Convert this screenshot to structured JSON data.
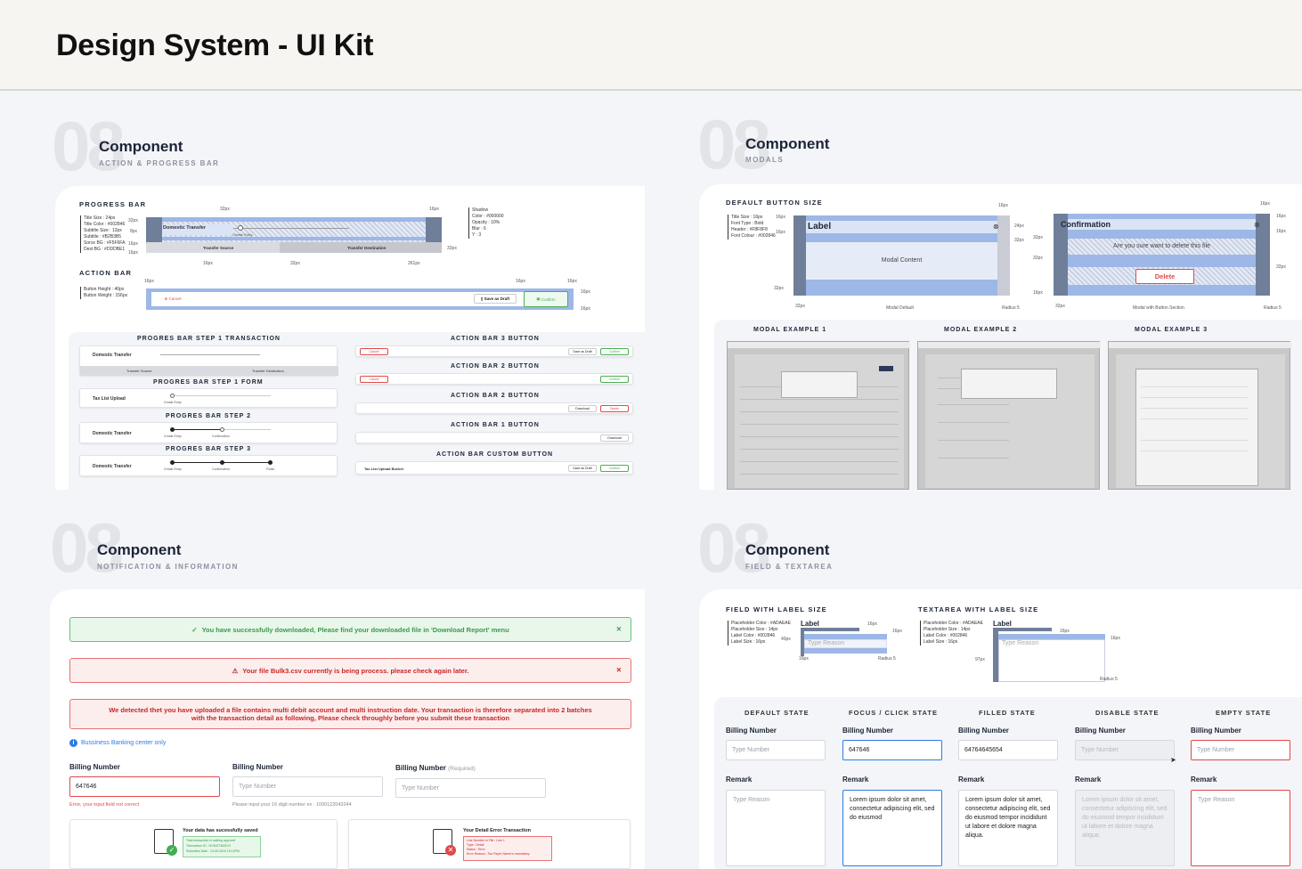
{
  "title": "Design System - UI Kit",
  "section_number": "08",
  "q1": {
    "heading": "Component",
    "subheading": "ACTION & PROGRESS BAR",
    "progress_label": "PROGRESS BAR",
    "spec": [
      "Title Size : 24px",
      "Title Color : #002846",
      "Subtitle Size : 12px",
      "Subtitle : #B2B3B5",
      "Sorce BG : #F5F6FA",
      "Dest BG : #DDDBE1"
    ],
    "spec_px": [
      "32px",
      "8px",
      "16px",
      "16px"
    ],
    "shadow": [
      "Shadow",
      "Color : #000000",
      "Opacity : 10%",
      "Blur : 6",
      "Y : 3"
    ],
    "dims": {
      "a": "32px",
      "b": "16px",
      "c": "16px",
      "d": "32px",
      "e": "16px",
      "f": "32px",
      "g": "261px"
    },
    "pb": {
      "title": "Domestic Transfer",
      "step1": "Create Entry",
      "source": "Transfer Source",
      "dest": "Transfer Destination"
    },
    "action_label": "ACTION BAR",
    "action_spec": [
      "Button Height : 40px",
      "Button Weight : 156px"
    ],
    "action_dims": {
      "a": "16px",
      "b": "16px",
      "c": "16px",
      "d": "16px",
      "e": "16px"
    },
    "ab": {
      "cancel": "Cancel",
      "draft": "Save as Draft",
      "confirm": "Confirm"
    },
    "left_titles": [
      "PROGRES BAR STEP 1 TRANSACTION",
      "PROGRES BAR STEP 1 FORM",
      "PROGRES BAR STEP 2",
      "PROGRES BAR STEP 3"
    ],
    "left_items": [
      "Domestic Transfer",
      "Tax List Upload",
      "Domestic Transfer",
      "Domestic Transfer"
    ],
    "steps": [
      "Create Entry",
      "Confirmation",
      "Finish"
    ],
    "right_titles": [
      "ACTION BAR 3 BUTTON",
      "ACTION BAR 2 BUTTON",
      "ACTION BAR 2 BUTTON",
      "ACTION BAR 1 BUTTON",
      "ACTION BAR CUSTOM BUTTON"
    ],
    "rb": {
      "cancel": "Cancel",
      "draft": "Save as Draft",
      "confirm": "Confirm",
      "download": "Download",
      "delete": "Delete",
      "bucket": "Tax List Upload Bucket"
    }
  },
  "q2": {
    "heading": "Component",
    "subheading": "MODALS",
    "label": "DEFAULT BUTTON SIZE",
    "spec": [
      "Title Size : 16px",
      "Font Type : Bold",
      "Header : #F8F8F8",
      "Font Colour : #002846"
    ],
    "spec_px": [
      "16px",
      "16px"
    ],
    "m1": {
      "title": "Label",
      "content": "Modal Content",
      "caption": "Modal Default",
      "radius": "Radius 5",
      "d16": "16px",
      "d24": "24px",
      "d32": "32px",
      "d32b": "32px",
      "d32c": "32px"
    },
    "m2": {
      "title": "Confirmation",
      "content": "Are you sure want to delete this file",
      "button": "Delete",
      "caption": "Modal with Button Section",
      "radius": "Radius 5",
      "d16": "16px",
      "d16b": "16px",
      "d32": "32px",
      "d32b": "32px",
      "d16c": "16px",
      "d32c": "32px"
    },
    "examples": [
      "MODAL EXAMPLE 1",
      "MODAL EXAMPLE 2",
      "MODAL EXAMPLE 3"
    ]
  },
  "q3": {
    "heading": "Component",
    "subheading": "NOTIFICATION & INFORMATION",
    "success": "You have successfully downloaded, Please find your downloaded file in 'Download Report' menu",
    "warning": "Your file Bulk3.csv currently is being process. please check again later.",
    "error": "We detected thet you have uploaded a file contains multi debit account and multi instruction date. Your transaction is therefore separated into 2 batches with the transaction detail as following, Please check throughly before you submit these transaction",
    "info": "Bussiness Banking center only",
    "f1": {
      "label": "Billing Number",
      "value": "647646",
      "error": "Error, your input field not correct"
    },
    "f2": {
      "label": "Billing Number",
      "placeholder": "Type Number",
      "hint": "Please input your 16 digit number ex : 1000122043244"
    },
    "f3": {
      "label": "Billing Number",
      "req": "(Required)",
      "placeholder": "Type Number"
    },
    "c1": {
      "title": "Your data has sucessfully saved",
      "lines": [
        "Total transaction is waiting approvel",
        "Transaction ID : 00 8437383013",
        "Submitted Date : 14-05-2019 15:12PM"
      ]
    },
    "c2": {
      "title": "Your Detail Error Transaction",
      "lines": [
        "Line Number in File : Line 1",
        "Type : Detail",
        "Status : Error",
        "Error Reason : Tax Payer Name is mandatory"
      ]
    }
  },
  "q4": {
    "heading": "Component",
    "subheading": "FIELD & TEXTAREA",
    "fl": "FIELD WITH LABEL SIZE",
    "tl": "TEXTAREA WITH LABEL SIZE",
    "fspec": [
      "Placeholder Color : #ADAEAE",
      "Placeholder Size : 14px",
      "Label Color : #002846",
      "Label Size : 16px"
    ],
    "tspec": [
      "Placeholder Color : #ADAEAE",
      "Placeholder Size : 14px",
      "Label Color : #002846",
      "Label Size : 16px"
    ],
    "fdemo": {
      "label": "Label",
      "placeholder": "Type Reason",
      "d16a": "16px",
      "d16b": "16px",
      "d40": "40px",
      "d16c": "16px",
      "radius": "Radius 5"
    },
    "tdemo": {
      "label": "Label",
      "placeholder": "Type Reason",
      "d16a": "16px",
      "d16b": "16px",
      "d97": "97px",
      "radius": "Radius 5"
    },
    "states": [
      "DEFAULT STATE",
      "FOCUS / CLICK STATE",
      "FILLED STATE",
      "DISABLE STATE",
      "EMPTY STATE"
    ],
    "billing": "Billing Number",
    "remark": "Remark",
    "ph_num": "Type Number",
    "ph_reason": "Type Reason",
    "focus_val": "647646",
    "filled_val": "64764645654",
    "lorem1": "Lorem ipsum dolor sit amet, consectetur adipiscing elit, sed do eiusmod",
    "lorem2": "Lorem ipsum dolor sit amet, consectetur adipiscing elit, sed do eiusmod tempor incididunt ut labore et dolore magna aliqua.",
    "lorem3": "Lorem ipsum dolor sit amet, consectetur adipiscing elit, sed do eiusmod tempor incididunt ut labore et dolore magna aliqua."
  },
  "colors": {
    "accent": "#9db7e6",
    "error": "#e04a4a",
    "success": "#3fae50",
    "info": "#2f7be6"
  }
}
